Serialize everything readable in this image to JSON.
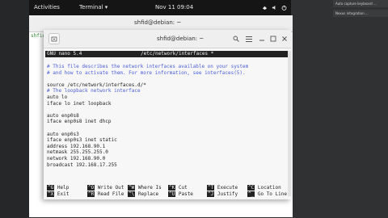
{
  "topbar": {
    "activities": "Activities",
    "app_menu": "Terminal ▾",
    "clock": "Nov 11  09:04"
  },
  "notifications": {
    "items": [
      "Auto capture keyboard ...",
      "Nexus integration ..."
    ]
  },
  "back_window": {
    "title": "shfid@debian: ~",
    "prompt": "shfid"
  },
  "front_window": {
    "title": "shfid@debian: ~"
  },
  "nano": {
    "version": "GNU nano 5.4",
    "filename": "/etc/network/interfaces *",
    "lines": [
      {
        "text": "# This file describes the network interfaces available on your system",
        "comment": true
      },
      {
        "text": "# and how to activate them. For more information, see interfaces(5).",
        "comment": true
      },
      {
        "text": "",
        "comment": false
      },
      {
        "text": "source /etc/network/interfaces.d/*",
        "comment": false
      },
      {
        "text": "# The loopback network interface",
        "comment": true
      },
      {
        "text": "auto lo",
        "comment": false
      },
      {
        "text": "iface lo inet loopback",
        "comment": false
      },
      {
        "text": "",
        "comment": false
      },
      {
        "text": "auto enp0s8",
        "comment": false
      },
      {
        "text": "iface enp0s8 inet dhcp",
        "comment": false
      },
      {
        "text": "",
        "comment": false
      },
      {
        "text": "auto enp0s3",
        "comment": false
      },
      {
        "text": "iface enp0s3 inet static",
        "comment": false
      },
      {
        "text": "address 192.168.90.1",
        "comment": false
      },
      {
        "text": "netmask 255.255.255.0",
        "comment": false
      },
      {
        "text": "network 192.168.90.0",
        "comment": false
      },
      {
        "text": "broadcast 192.168.17.255",
        "comment": false
      }
    ],
    "shortcuts_row1": [
      {
        "key": "^G",
        "label": "Help"
      },
      {
        "key": "^O",
        "label": "Write Out"
      },
      {
        "key": "^W",
        "label": "Where Is"
      },
      {
        "key": "^K",
        "label": "Cut"
      },
      {
        "key": "^T",
        "label": "Execute"
      },
      {
        "key": "^C",
        "label": "Location"
      }
    ],
    "shortcuts_row2": [
      {
        "key": "^X",
        "label": "Exit"
      },
      {
        "key": "^R",
        "label": "Read File"
      },
      {
        "key": "^\\",
        "label": "Replace"
      },
      {
        "key": "^U",
        "label": "Paste"
      },
      {
        "key": "^J",
        "label": "Justify"
      },
      {
        "key": "^_",
        "label": "Go To Line"
      }
    ]
  },
  "colors": {
    "comment": "#4a5fd6",
    "topbar": "#151515"
  }
}
